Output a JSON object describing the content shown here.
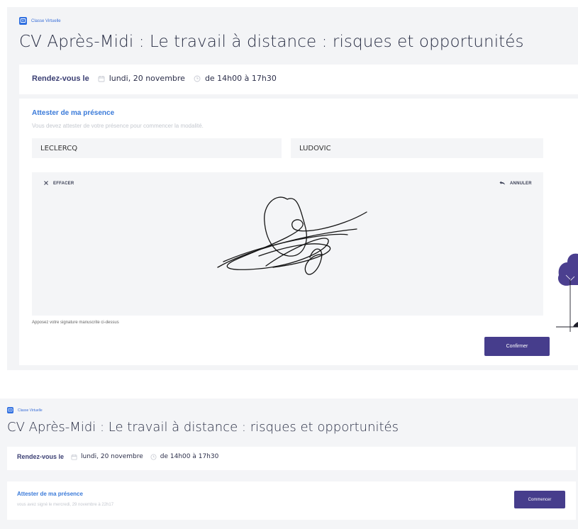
{
  "panel_a": {
    "type_label": "Classe Virtuelle",
    "title": "CV Après-Midi : Le travail à distance : risques et opportunités",
    "rdv": {
      "label": "Rendez-vous le",
      "date": "lundi, 20 novembre",
      "time": "de 14h00 à 17h30"
    },
    "attest": {
      "title": "Attester de ma présence",
      "subtitle": "Vous devez attester de votre présence pour commencer la modalité.",
      "last_name": "LECLERCQ",
      "first_name": "LUDOVIC",
      "clear_label": "EFFACER",
      "undo_label": "ANNULER",
      "hint": "Apposez votre signature manuscrite ci-dessus",
      "confirm_label": "Confirmer"
    }
  },
  "panel_b": {
    "type_label": "Classe Virtuelle",
    "title": "CV Après-Midi : Le travail à distance : risques et opportunités",
    "rdv": {
      "label": "Rendez-vous le",
      "date": "lundi, 20 novembre",
      "time": "de 14h00 à 17h30"
    },
    "attest": {
      "title": "Attester de ma présence",
      "subtitle": "vous avez signé le mercredi, 29 novembre à 22h17",
      "start_label": "Commencer"
    }
  },
  "icons": {
    "type": "virtual-class-icon",
    "calendar": "calendar-icon",
    "clock": "clock-icon",
    "clear": "close-icon",
    "undo": "undo-icon"
  },
  "colors": {
    "accent_blue": "#3a7ad9",
    "button_purple": "#463d8c",
    "tree_purple": "#4b3f8f",
    "panel_bg": "#f3f4f6"
  }
}
